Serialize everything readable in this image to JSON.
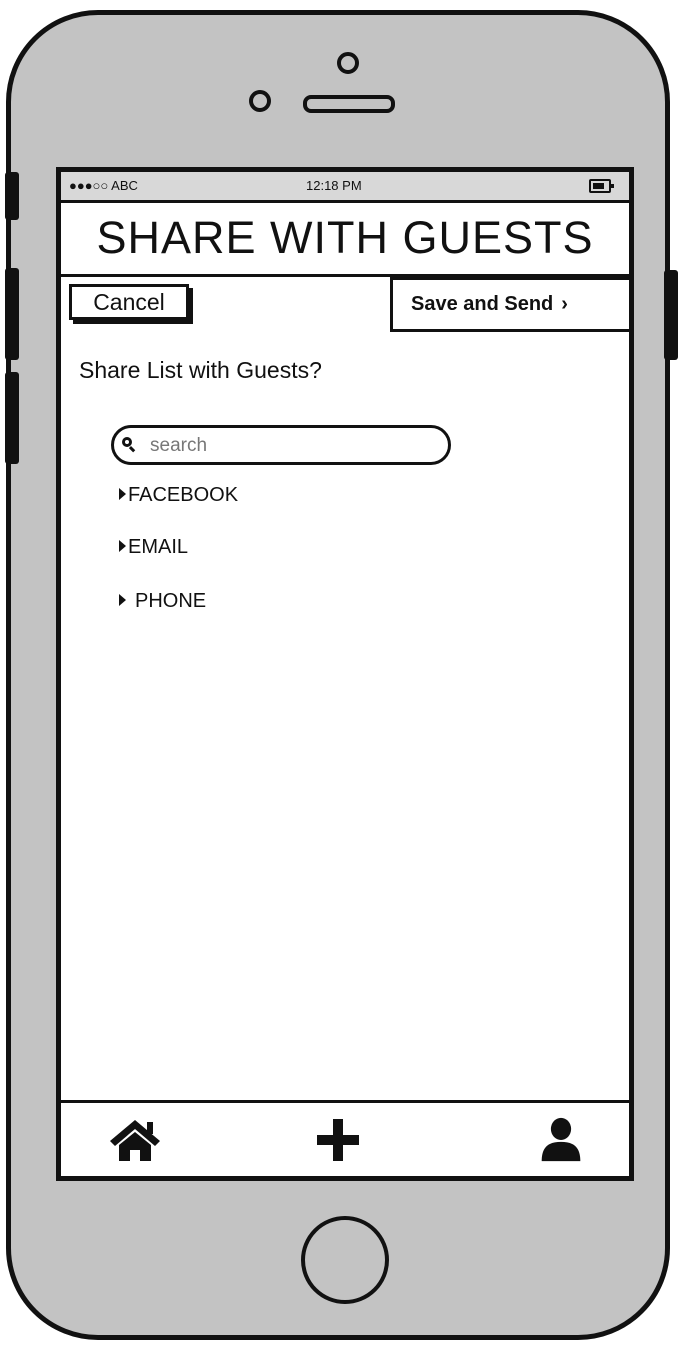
{
  "status_bar": {
    "carrier": "●●●○○ ABC",
    "time": "12:18 PM"
  },
  "header": {
    "title": "SHARE WITH GUESTS"
  },
  "actions": {
    "cancel_label": "Cancel",
    "save_label": "Save and Send",
    "save_chevron": "›"
  },
  "prompt": "Share List with Guests?",
  "search": {
    "placeholder": "search",
    "value": ""
  },
  "options": [
    {
      "label": "FACEBOOK"
    },
    {
      "label": "EMAIL"
    },
    {
      "label": "PHONE"
    }
  ],
  "tabbar": {
    "items": [
      {
        "icon": "home-icon"
      },
      {
        "icon": "plus-icon"
      },
      {
        "icon": "user-icon"
      }
    ]
  }
}
